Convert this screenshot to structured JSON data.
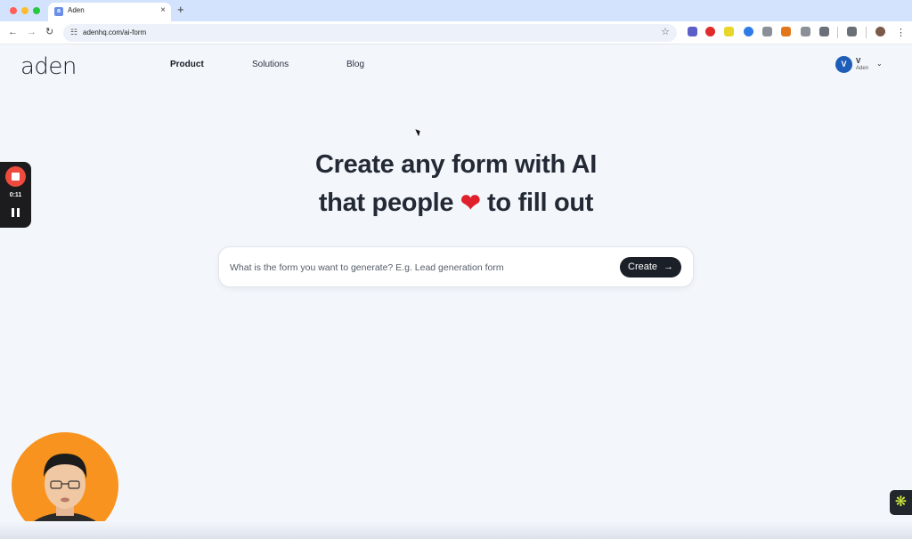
{
  "browser": {
    "tab_title": "Aden",
    "tab_favicon": "a",
    "new_tab": "+",
    "close_tab": "×",
    "url": "adenhq.com/ai-form",
    "back": "←",
    "forward": "→",
    "reload": "↻",
    "site_info": "☷",
    "bookmark": "☆",
    "menu": "⋮"
  },
  "site": {
    "logo": "aden",
    "nav": [
      "Product",
      "Solutions",
      "Blog"
    ],
    "user": {
      "initial": "V",
      "name": "V",
      "org": "Aden"
    }
  },
  "hero": {
    "line1": "Create any form with AI",
    "line2_pre": "that people ",
    "heart": "❤",
    "line2_post": " to fill out"
  },
  "prompt": {
    "placeholder": "What is the form you want to generate? E.g. Lead generation form",
    "button": "Create",
    "button_arrow": "→"
  },
  "recorder": {
    "time": "0:11"
  },
  "colors": {
    "accent": "#1b1f27",
    "background": "#f3f6fb",
    "recording_red": "#ee4b3e",
    "avatar_blue": "#1e5eb8",
    "webcam_bg": "#f7931e"
  },
  "icons": {
    "help": "help-widget-icon"
  }
}
